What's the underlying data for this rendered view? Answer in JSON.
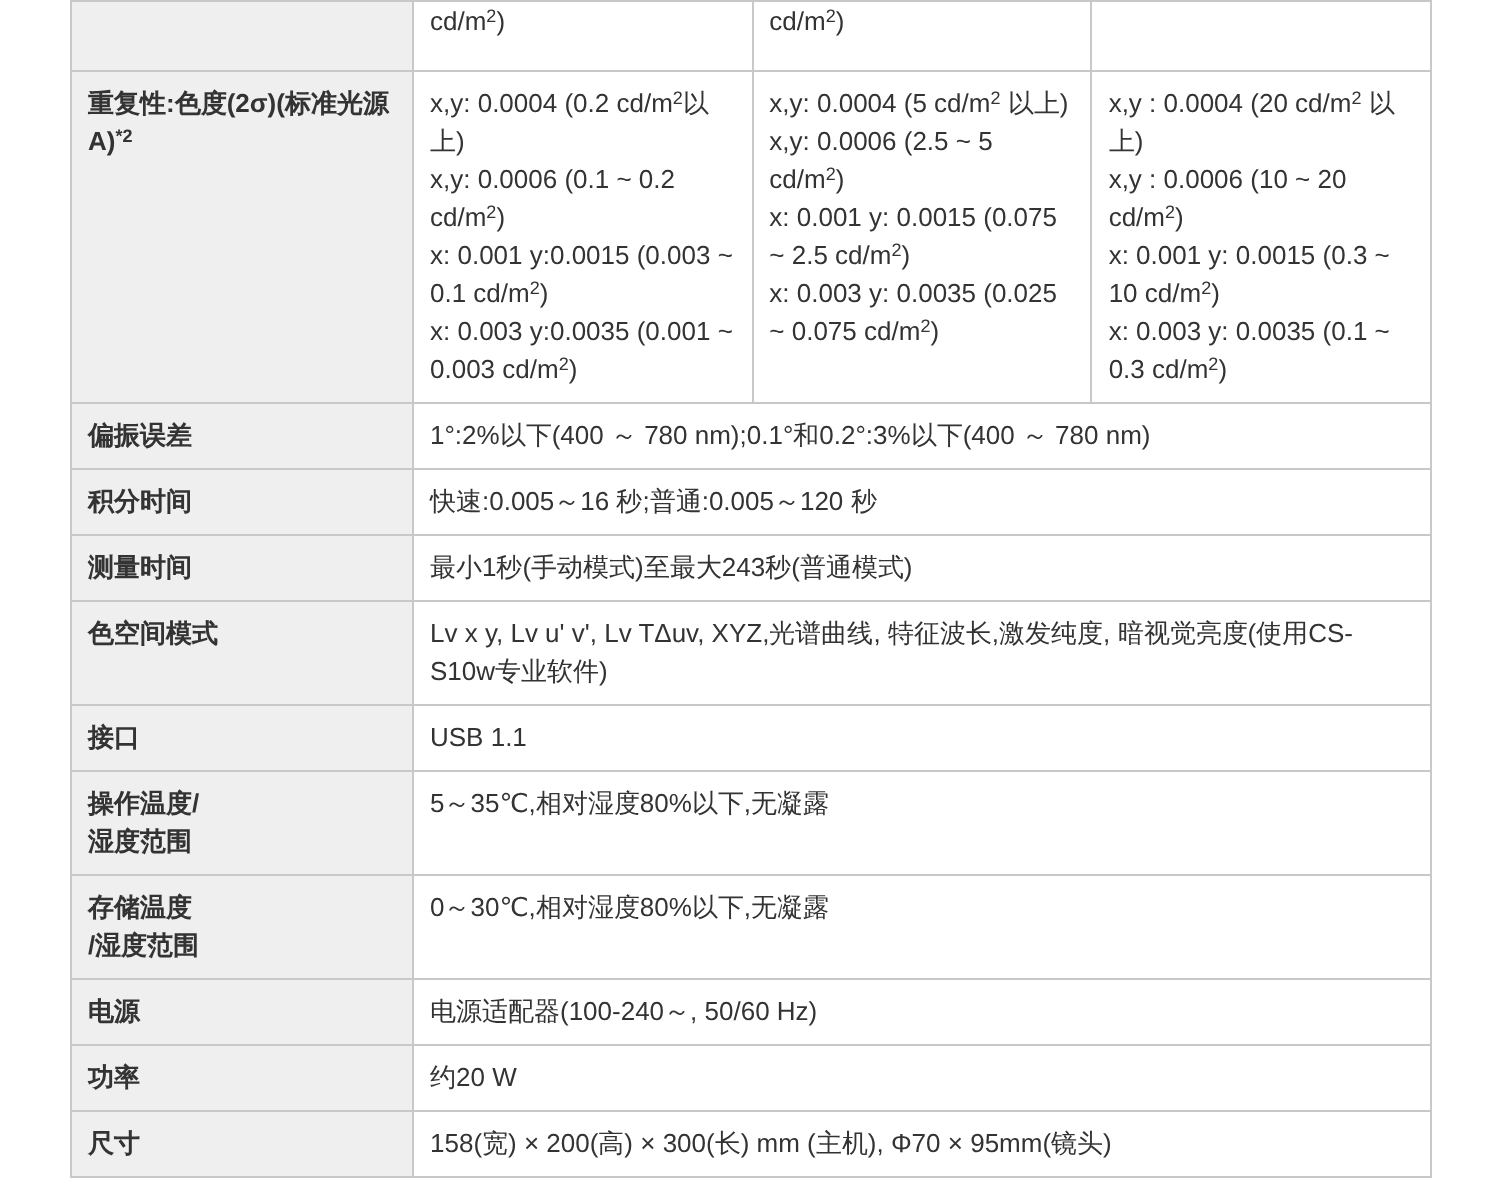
{
  "spec_table": {
    "rows": [
      {
        "values": [
          [
            "cd/m$^{2}$)"
          ],
          [
            "cd/m$^{2}$)"
          ]
        ]
      },
      {
        "label": "重复性:色度(2σ)(标准光源A)$^{*2}$",
        "values": [
          [
            "x,y: 0.0004 (0.2 cd/m$^{2}$以上)",
            "x,y: 0.0006 (0.1 ~ 0.2 cd/m$^{2}$)",
            "x: 0.001 y:0.0015 (0.003 ~ 0.1 cd/m$^{2}$)",
            "x: 0.003 y:0.0035 (0.001 ~ 0.003 cd/m$^{2}$)"
          ],
          [
            "x,y: 0.0004 (5 cd/m$^{2}$ 以上)",
            "x,y: 0.0006 (2.5 ~ 5 cd/m$^{2}$)",
            "x: 0.001 y: 0.0015 (0.075 ~ 2.5 cd/m$^{2}$)",
            "x: 0.003 y: 0.0035 (0.025 ~ 0.075 cd/m$^{2}$)"
          ],
          [
            "x,y : 0.0004 (20 cd/m$^{2}$ 以上)",
            "x,y : 0.0006 (10 ~ 20 cd/m$^{2}$)",
            "x: 0.001 y: 0.0015 (0.3 ~ 10 cd/m$^{2}$)",
            "x: 0.003 y: 0.0035 (0.1 ~ 0.3 cd/m$^{2}$)"
          ]
        ]
      },
      {
        "label": "偏振误差",
        "values": [
          [
            "1°:2%以下(400 ～ 780 nm);0.1°和0.2°:3%以下(400 ～ 780 nm)"
          ]
        ]
      },
      {
        "label": "积分时间",
        "values": [
          [
            "快速:0.005～16 秒;普通:0.005～120 秒"
          ]
        ]
      },
      {
        "label": "测量时间",
        "values": [
          [
            "最小1秒(手动模式)至最大243秒(普通模式)"
          ]
        ]
      },
      {
        "label": "色空间模式",
        "values": [
          [
            "Lv x y, Lv u' v', Lv TΔuv, XYZ,光谱曲线, 特征波长,激发纯度, 暗视觉亮度(使用CS-S10w专业软件)"
          ]
        ]
      },
      {
        "label": "接口",
        "values": [
          [
            "USB 1.1"
          ]
        ]
      },
      {
        "label": "操作温度/\n湿度范围",
        "values": [
          [
            "5～35℃,相对湿度80%以下,无凝露"
          ]
        ]
      },
      {
        "label": "存储温度\n/湿度范围",
        "values": [
          [
            "0～30℃,相对湿度80%以下,无凝露"
          ]
        ]
      },
      {
        "label": "电源",
        "values": [
          [
            "电源适配器(100-240～, 50/60 Hz)"
          ]
        ]
      },
      {
        "label": "功率",
        "values": [
          [
            "约20 W"
          ]
        ]
      },
      {
        "label": "尺寸",
        "values": [
          [
            "158(宽) × 200(高) × 300(长) mm (主机), Φ70 × 95mm(镜头)"
          ]
        ]
      }
    ]
  }
}
